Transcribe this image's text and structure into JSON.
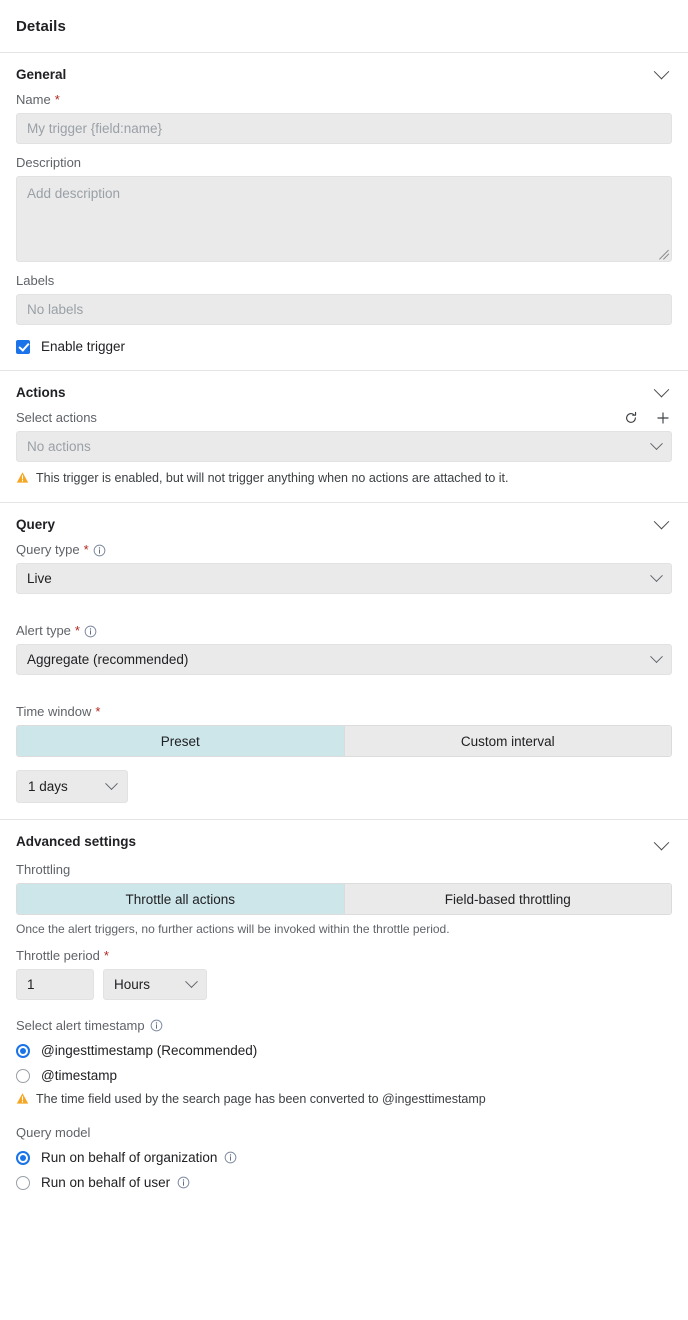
{
  "header": {
    "title": "Details"
  },
  "colors": {
    "accent_blue": "#1a73e8",
    "segment_selected": "#cde6ea",
    "field_bg": "#eaeaea",
    "warning_amber": "#f5a623",
    "required_red": "#b3261e"
  },
  "general": {
    "title": "General",
    "name_label": "Name",
    "name_placeholder": "My trigger {field:name}",
    "name_value": "",
    "description_label": "Description",
    "description_placeholder": "Add description",
    "description_value": "",
    "labels_label": "Labels",
    "labels_placeholder": "No labels",
    "labels_value": "",
    "enable_trigger_label": "Enable trigger",
    "enable_trigger_checked": true
  },
  "actions": {
    "title": "Actions",
    "select_actions_label": "Select actions",
    "refresh_icon": "refresh-icon",
    "add_icon": "plus-icon",
    "select_value": "No actions",
    "warning": "This trigger is enabled, but will not trigger anything when no actions are attached to it."
  },
  "query": {
    "title": "Query",
    "query_type_label": "Query type",
    "query_type_value": "Live",
    "alert_type_label": "Alert type",
    "alert_type_value": "Aggregate (recommended)",
    "time_window_label": "Time window",
    "time_window_options": [
      "Preset",
      "Custom interval"
    ],
    "time_window_selected": "Preset",
    "preset_value": "1 days"
  },
  "advanced": {
    "title": "Advanced settings",
    "throttling_label": "Throttling",
    "throttling_options": [
      "Throttle all actions",
      "Field-based throttling"
    ],
    "throttling_selected": "Throttle all actions",
    "throttling_hint": "Once the alert triggers, no further actions will be invoked within the throttle period.",
    "throttle_period_label": "Throttle period",
    "throttle_period_value": "1",
    "throttle_period_unit": "Hours",
    "timestamp_label": "Select alert timestamp",
    "timestamp_options": [
      {
        "label": "@ingesttimestamp (Recommended)",
        "selected": true
      },
      {
        "label": "@timestamp",
        "selected": false
      }
    ],
    "timestamp_warning": "The time field used by the search page has been converted to @ingesttimestamp",
    "query_model_label": "Query model",
    "query_model_options": [
      {
        "label": "Run on behalf of organization",
        "selected": true
      },
      {
        "label": "Run on behalf of user",
        "selected": false
      }
    ]
  }
}
